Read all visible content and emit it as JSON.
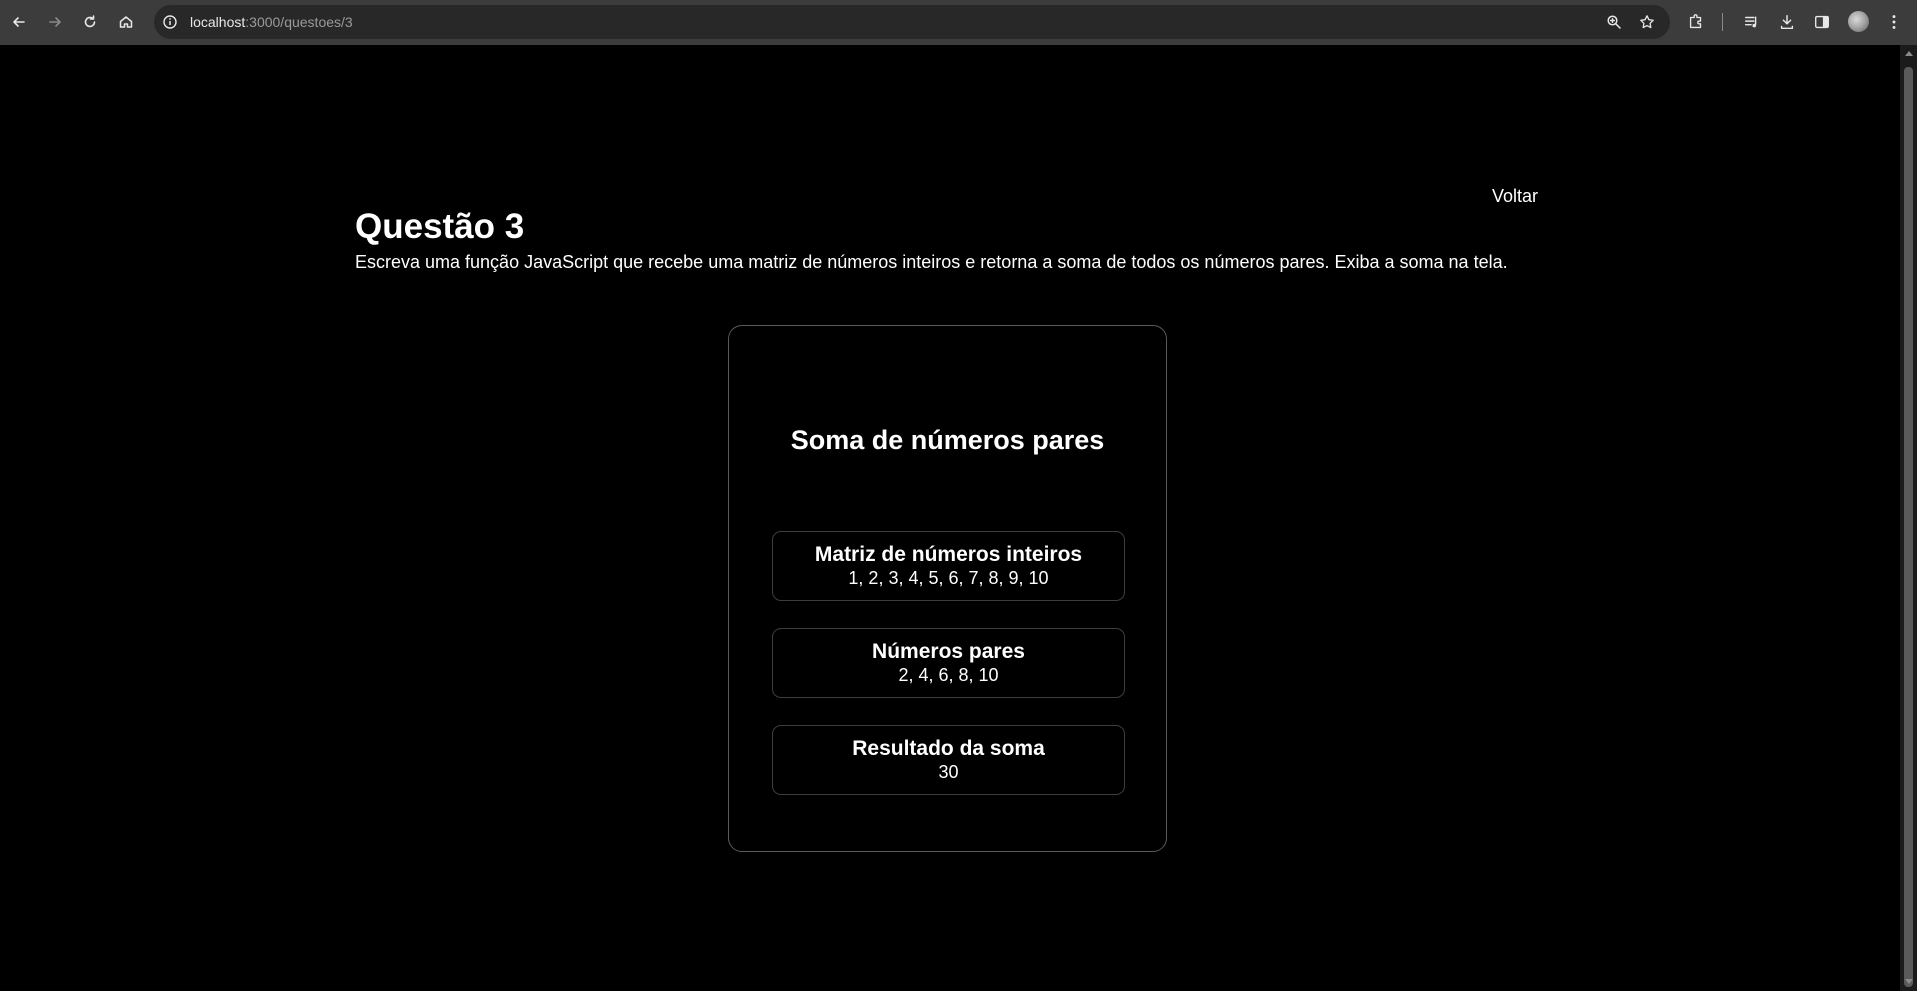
{
  "browser": {
    "url_host": "localhost",
    "url_path": ":3000/questoes/3"
  },
  "page": {
    "back_label": "Voltar",
    "title": "Questão 3",
    "description": "Escreva uma função JavaScript que recebe uma matriz de números inteiros e retorna a soma de todos os números pares. Exiba a soma na tela."
  },
  "card": {
    "title": "Soma de números pares",
    "items": [
      {
        "label": "Matriz de números inteiros",
        "value": "1, 2, 3, 4, 5, 6, 7, 8, 9, 10"
      },
      {
        "label": "Números pares",
        "value": "2, 4, 6, 8, 10"
      },
      {
        "label": "Resultado da soma",
        "value": "30"
      }
    ]
  },
  "colors": {
    "background": "#000000",
    "text": "#ffffff",
    "card_border": "#5a5a5a",
    "browser_bar": "#3c3c3c"
  }
}
